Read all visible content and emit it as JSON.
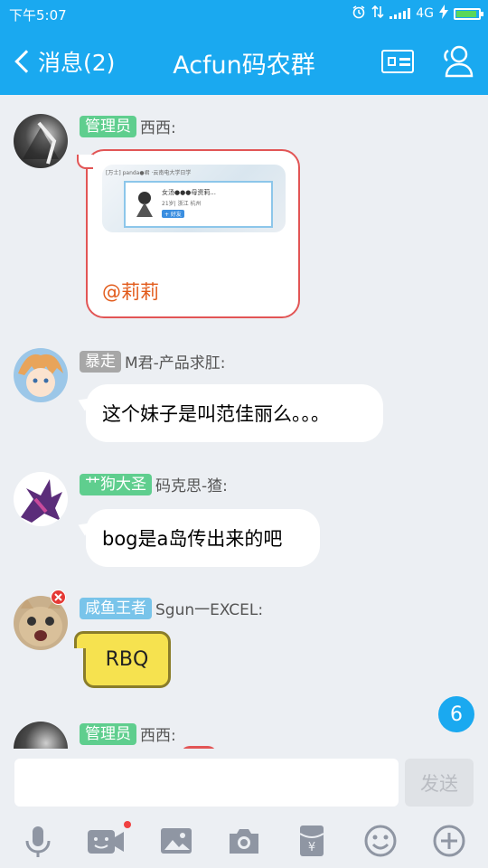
{
  "status_bar": {
    "time": "下午5:07",
    "network": "4G"
  },
  "nav": {
    "back_label": "消息(2)",
    "title": "Acfun码农群"
  },
  "messages": [
    {
      "badge": "管理员",
      "badge_color": "#5fce8e",
      "sender": "西西:",
      "image_card": {
        "mini_line": "[万士] panda●君 ·云南电大学日学",
        "name_line": "女汤●●●母资莉...",
        "info_line": "21岁| 浙江 杭州",
        "tag": "+ 好友"
      },
      "mention": "@莉莉"
    },
    {
      "badge": "暴走",
      "badge_color": "#a7a7a7",
      "sender": "M君-产品求肛:",
      "text": "这个妹子是叫范佳丽么。。。"
    },
    {
      "badge": "艹狗大圣",
      "badge_color": "#5fce8e",
      "sender": "码克思-猹:",
      "text": "bog是a岛传出来的吧"
    },
    {
      "badge": "咸鱼王者",
      "badge_color": "#79c4ea",
      "sender": "Sgun一EXCEL:",
      "text": "RBQ"
    },
    {
      "badge": "管理员",
      "badge_color": "#5fce8e",
      "sender": "西西:"
    }
  ],
  "unread_count": "6",
  "input": {
    "placeholder": "",
    "send_label": "发送"
  },
  "toolbar_icons": [
    "microphone-icon",
    "video-call-icon",
    "image-icon",
    "camera-icon",
    "red-packet-icon",
    "emoji-icon",
    "plus-icon"
  ],
  "colors": {
    "accent": "#1aa9f0",
    "mention": "#e25b1b",
    "notification_dot": "#f04141"
  }
}
